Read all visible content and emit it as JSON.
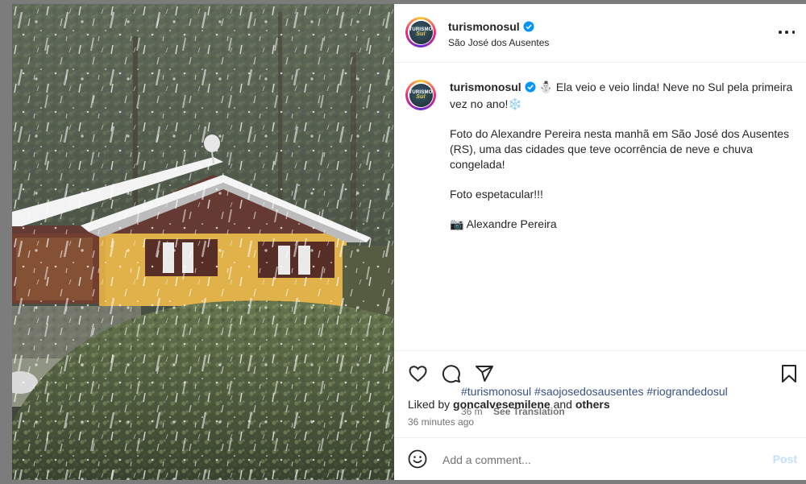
{
  "post": {
    "username": "turismonosul",
    "location": "São José dos Ausentes",
    "avatar_text_top": "TURISMO",
    "avatar_text_bottom": "Sul",
    "caption": {
      "line1": "Ela veio e veio linda! Neve no Sul pela primeira vez no ano!",
      "line2": "Foto do Alexandre Pereira nesta manhã em São José dos Ausentes (RS), uma das cidades que teve ocorrência de neve e chuva congelada!",
      "line3": "Foto espetacular!!!",
      "line4": "Alexandre Pereira",
      "emoji_snowman": "⛄",
      "emoji_snowflake": "❄️",
      "emoji_camera": "📷"
    },
    "hashtags": [
      "#turismonosul",
      "#saojosedosausentes",
      "#riograndedosul"
    ],
    "time_short": "36 m",
    "see_translation": "See Translation",
    "liked_by_prefix": "Liked by",
    "liked_by_user": "goncalvesemilene",
    "liked_by_and": "and",
    "liked_by_others": "others",
    "time_long": "36 minutes ago",
    "comment_placeholder": "Add a comment...",
    "post_label": "Post"
  },
  "colors": {
    "link": "#385185",
    "verified": "#0095f6",
    "muted": "#737373",
    "post_disabled": "#c0dffd"
  },
  "icons": [
    "more-icon",
    "verified-icon",
    "heart-icon",
    "comment-icon",
    "share-icon",
    "bookmark-icon",
    "emoji-icon"
  ]
}
